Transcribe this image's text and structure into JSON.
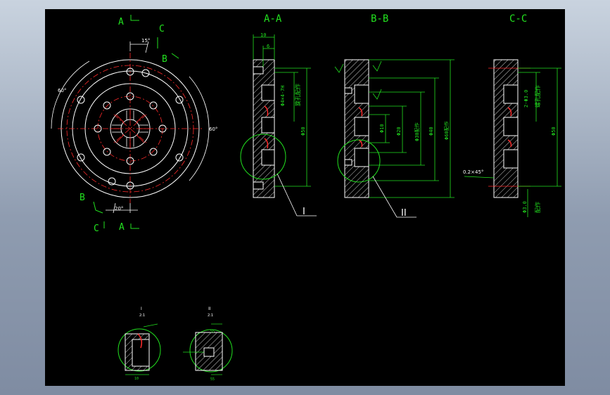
{
  "colors": {
    "background": "#000000",
    "outline": "#ffffff",
    "dimension": "#22e11f",
    "centerline": "#ff2a2a",
    "hatch": "#ffffff"
  },
  "plan_view": {
    "section_marks": {
      "a_top": "A",
      "c_top": "C",
      "b_top": "B",
      "b_bottom": "B",
      "c_bottom": "C",
      "a_bottom": "A"
    },
    "angles": {
      "top": "15°",
      "left": "60°",
      "right": "60°",
      "bottom": "20°"
    }
  },
  "sections": {
    "aa": {
      "title": "A-A",
      "dim_width": "10",
      "dim_depth": "6",
      "dim_dia": "Φ50",
      "note": "Φ4×4-7H",
      "note2": "旋孔配作",
      "detail": "I"
    },
    "bb": {
      "title": "B-B",
      "dim_10": "Φ10",
      "dim_20": "Φ20",
      "dim_30": "Φ30配作",
      "dim_40": "Φ40",
      "dim_60": "Φ60配作",
      "detail": "II"
    },
    "cc": {
      "title": "C-C",
      "dim_top": "2-Φ3.0",
      "note": "螺孔配作",
      "dim_dia": "Φ50",
      "chamfer": "0.2×45°",
      "dim_bottom": "Φ3.0",
      "note_bottom": "配作"
    }
  },
  "details": {
    "one": {
      "label": "I",
      "scale": "2:1",
      "dim": "10"
    },
    "two": {
      "label": "II",
      "scale": "2:1",
      "dim_top": "55",
      "dim_bottom": "55"
    }
  }
}
